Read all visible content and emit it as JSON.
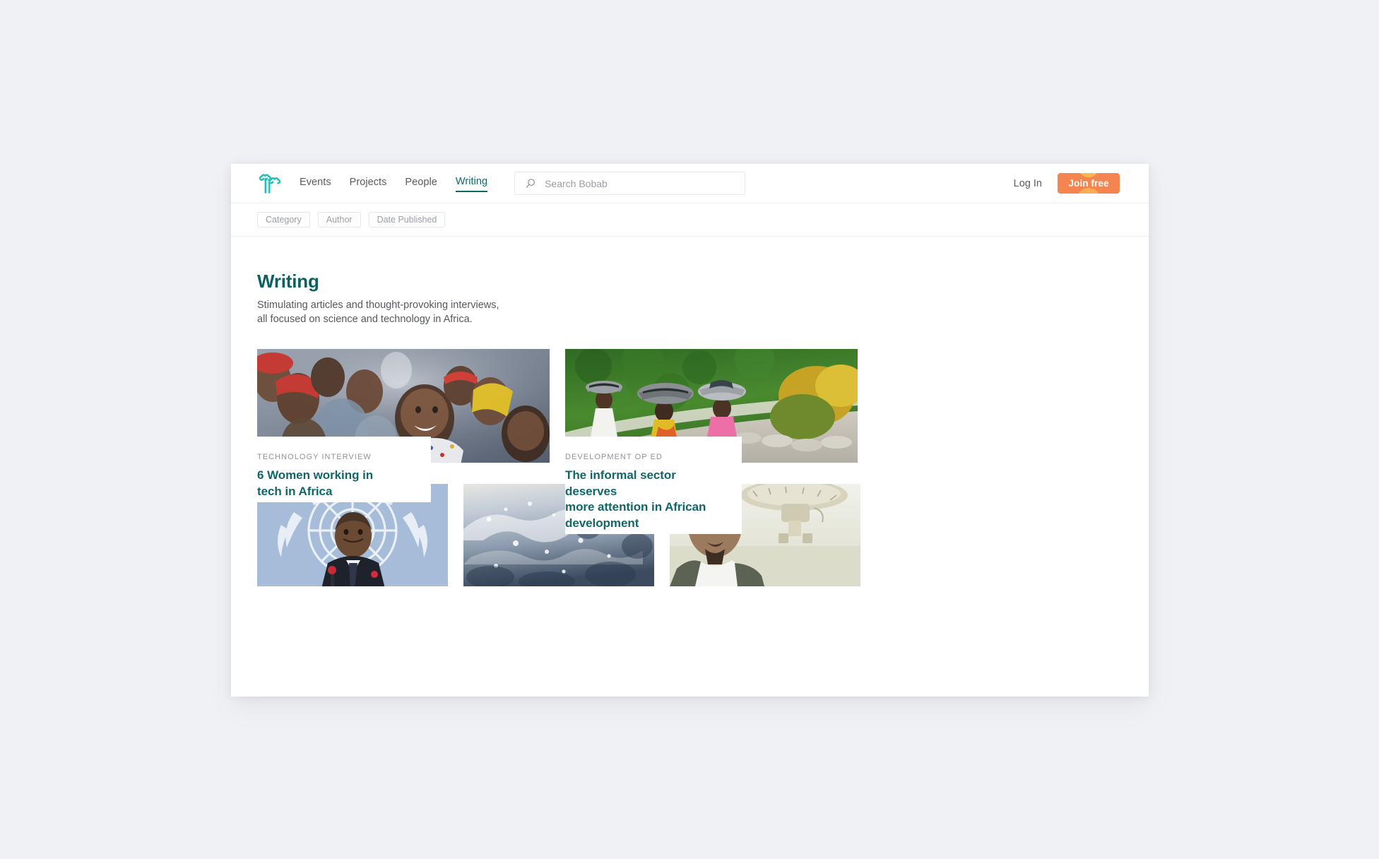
{
  "brand": {
    "logo_icon": "baobab-tree-logo",
    "logo_color": "#2bbfb8",
    "name": "Bobab"
  },
  "nav": {
    "items": [
      {
        "label": "Events",
        "active": false
      },
      {
        "label": "Projects",
        "active": false
      },
      {
        "label": "People",
        "active": false
      },
      {
        "label": "Writing",
        "active": true
      }
    ],
    "active_color": "#0e6a6a",
    "search": {
      "icon": "search-icon",
      "placeholder": "Search Bobab",
      "value": ""
    },
    "login_label": "Log In",
    "join_label": "Join free",
    "join_color": "#f58550"
  },
  "filters": {
    "pills": [
      {
        "label": "Category"
      },
      {
        "label": "Author"
      },
      {
        "label": "Date Published"
      }
    ]
  },
  "header": {
    "title": "Writing",
    "title_color": "#0c6060",
    "subtitle_line_1": "Stimulating articles and thought-provoking interviews,",
    "subtitle_line_2": "all focused on science and technology in Africa."
  },
  "articles": {
    "featured": [
      {
        "kicker": "TECHNOLOGY INTERVIEW",
        "headline_line_1": "6 Women working in",
        "headline_line_2": "tech in Africa",
        "image_alt": "crowd-of-smiling-african-women"
      },
      {
        "kicker": "DEVELOPMENT OP ED",
        "headline_line_1": "The informal sector deserves",
        "headline_line_2": "more attention in African",
        "headline_line_3": "development",
        "image_alt": "women-carrying-basins-on-heads"
      }
    ],
    "secondary": [
      {
        "image_alt": "man-in-suit-at-united-nations-podium"
      },
      {
        "image_alt": "splashing-water-closeup"
      },
      {
        "image_alt": "man-beside-satellite-dish"
      }
    ]
  }
}
